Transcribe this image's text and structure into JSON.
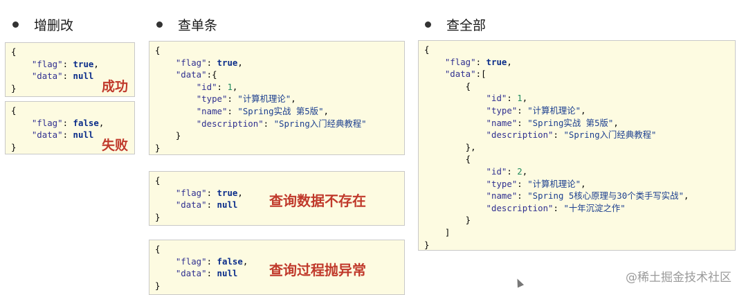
{
  "headings": {
    "h1": "增删改",
    "h2": "查单条",
    "h3": "查全部"
  },
  "annotations": {
    "success": "成功",
    "failure": "失败",
    "not_found": "查询数据不存在",
    "exception": "查询过程抛异常"
  },
  "watermark": "@稀土掘金技术社区",
  "json": {
    "flag_key": "\"flag\"",
    "data_key": "\"data\"",
    "id_key": "\"id\"",
    "type_key": "\"type\"",
    "name_key": "\"name\"",
    "desc_key": "\"description\"",
    "true": "true",
    "false": "false",
    "null": "null",
    "id1": "1",
    "id2": "2",
    "type_val": "\"计算机理论\"",
    "name1": "\"Spring实战 第5版\"",
    "desc1": "\"Spring入门经典教程\"",
    "name2": "\"Spring 5核心原理与30个类手写实战\"",
    "desc2": "\"十年沉淀之作\""
  },
  "colors": {
    "annotation": "#c0392b",
    "box_bg": "#fdfbe1",
    "key": "#303090",
    "number": "#208a5c"
  }
}
